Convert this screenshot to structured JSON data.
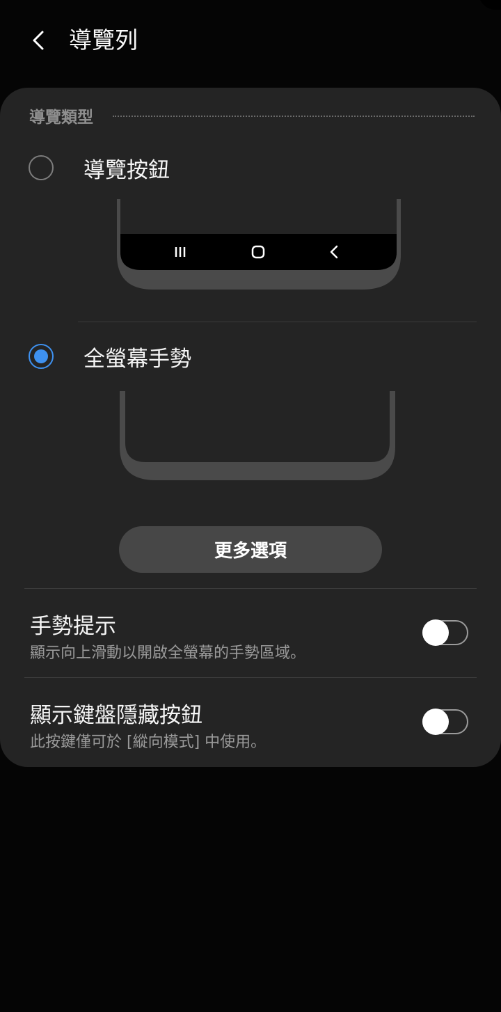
{
  "header": {
    "title": "導覽列",
    "back_icon": "chevron-left-icon"
  },
  "nav_type": {
    "section_title": "導覽類型",
    "options": [
      {
        "label": "導覽按鈕",
        "selected": false,
        "preview_icons": [
          "recents-icon",
          "home-icon",
          "back-icon"
        ]
      },
      {
        "label": "全螢幕手勢",
        "selected": true
      }
    ],
    "more_options_label": "更多選項"
  },
  "settings": [
    {
      "title": "手勢提示",
      "subtitle": "顯示向上滑動以開啟全螢幕的手勢區域。",
      "enabled": false
    },
    {
      "title": "顯示鍵盤隱藏按鈕",
      "subtitle": "此按鍵僅可於 [縱向模式] 中使用。",
      "enabled": false
    }
  ],
  "colors": {
    "accent": "#3e91f0",
    "card_background": "#242424",
    "page_background": "#050505",
    "button_background": "#474747"
  }
}
